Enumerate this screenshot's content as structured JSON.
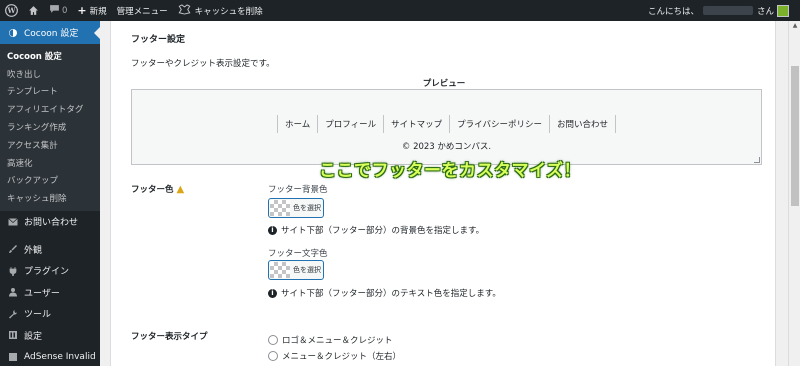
{
  "adminbar": {
    "wp_icon": "wordpress-icon",
    "home_icon": "home-icon",
    "comments_icon": "comment-icon",
    "comment_count": "0",
    "new_label": "新規",
    "admin_menu_label": "管理メニュー",
    "cache_label": "キャッシュを削除",
    "greeting": "こんにちは、",
    "san": "さん"
  },
  "sidebar": {
    "current": "Cocoon 設定",
    "submenu": [
      "Cocoon 設定",
      "吹き出し",
      "テンプレート",
      "アフィリエイトタグ",
      "ランキング作成",
      "アクセス集計",
      "高速化",
      "バックアップ",
      "キャッシュ削除"
    ],
    "items": [
      {
        "label": "お問い合わせ",
        "icon": "mail-icon"
      },
      {
        "label": "外観",
        "icon": "brush-icon"
      },
      {
        "label": "プラグイン",
        "icon": "plugin-icon"
      },
      {
        "label": "ユーザー",
        "icon": "user-icon"
      },
      {
        "label": "ツール",
        "icon": "wrench-icon"
      },
      {
        "label": "設定",
        "icon": "settings-icon"
      },
      {
        "label": "AdSense Invalid",
        "icon": "adsense-icon"
      }
    ]
  },
  "main": {
    "section_title": "フッター設定",
    "description": "フッターやクレジット表示設定です。",
    "preview_label": "プレビュー",
    "preview_nav": [
      "ホーム",
      "プロフィール",
      "サイトマップ",
      "プライバシーポリシー",
      "お問い合わせ"
    ],
    "preview_copyright": "© 2023 かめコンパス.",
    "callout": "ここでフッターをカスタマイズ！",
    "footer_color": {
      "label": "フッター色",
      "bg_label": "フッター背景色",
      "bg_button": "色を選択",
      "bg_note": "サイト下部（フッター部分）の背景色を指定します。",
      "text_label": "フッター文字色",
      "text_button": "色を選択",
      "text_note": "サイト下部（フッター部分）のテキスト色を指定します。"
    },
    "display_type": {
      "label": "フッター表示タイプ",
      "options": [
        "ロゴ＆メニュー＆クレジット",
        "メニュー＆クレジット（左右）"
      ]
    }
  },
  "colors": {
    "adminbar_bg": "#1d2327",
    "accent": "#2271b1",
    "callout_text": "#d8ff5a",
    "callout_outline": "#2b6b13",
    "warning": "#dba617"
  }
}
